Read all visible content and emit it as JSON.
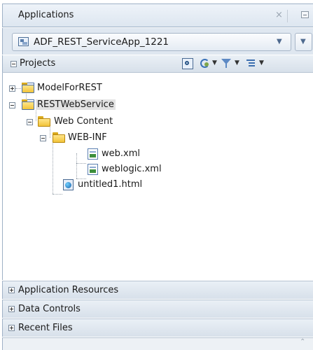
{
  "panel": {
    "title": "Applications",
    "close_glyph": "×"
  },
  "app_selector": {
    "value": "ADF_REST_ServiceApp_1221",
    "icon": "application-icon"
  },
  "projects": {
    "title": "Projects",
    "toolbar": [
      "search-icon",
      "sync-icon",
      "filter-icon",
      "layout-icon"
    ]
  },
  "tree": {
    "nodes": [
      {
        "label": "ModelForREST",
        "type": "project",
        "expanded": false
      },
      {
        "label": "RESTWebService",
        "type": "project",
        "expanded": true,
        "selected": true
      },
      {
        "label": "Web Content",
        "type": "folder",
        "expanded": true
      },
      {
        "label": "WEB-INF",
        "type": "folder",
        "expanded": true
      },
      {
        "label": "web.xml",
        "type": "xml-file"
      },
      {
        "label": "weblogic.xml",
        "type": "xml-file"
      },
      {
        "label": "untitled1.html",
        "type": "html-file"
      }
    ]
  },
  "sections": [
    {
      "label": "Application Resources"
    },
    {
      "label": "Data Controls"
    },
    {
      "label": "Recent Files"
    }
  ]
}
